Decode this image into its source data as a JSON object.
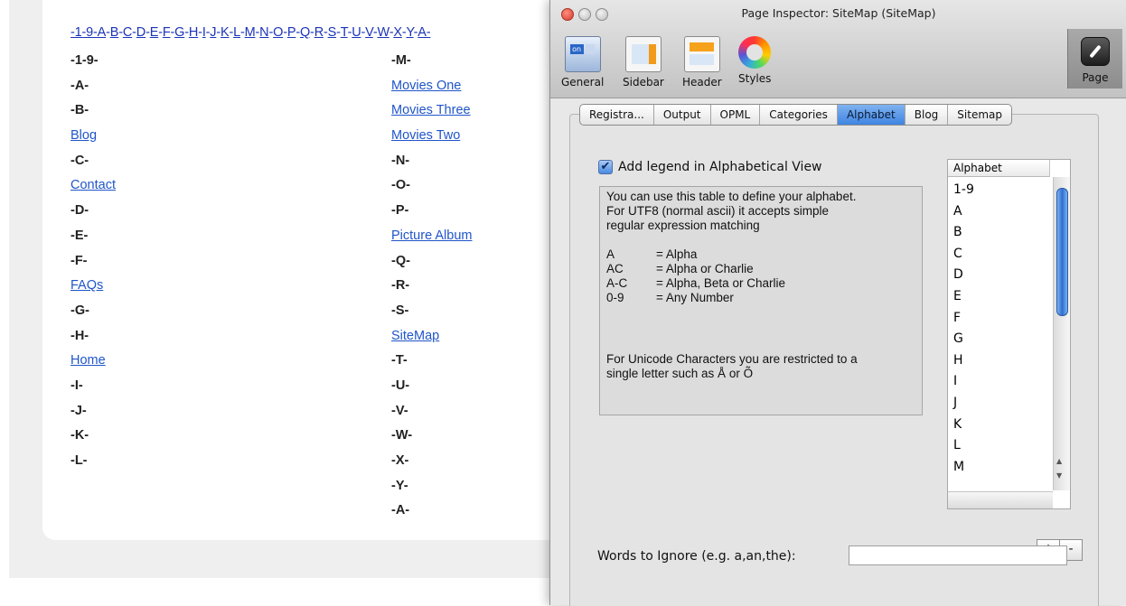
{
  "sitemap": {
    "alpha_nav": [
      "-1-9-",
      "A",
      "B",
      "C",
      "D",
      "E",
      "F",
      "G",
      "H",
      "I",
      "J",
      "K",
      "L",
      "M",
      "N",
      "O",
      "P",
      "Q",
      "R",
      "S",
      "T",
      "U",
      "V",
      "W",
      "X",
      "Y",
      "A-"
    ],
    "left_column": [
      {
        "text": "-1-9-",
        "type": "header"
      },
      {
        "text": "-A-",
        "type": "header"
      },
      {
        "text": "-B-",
        "type": "header"
      },
      {
        "text": "Blog",
        "type": "link"
      },
      {
        "text": "-C-",
        "type": "header"
      },
      {
        "text": "Contact",
        "type": "link"
      },
      {
        "text": "-D-",
        "type": "header"
      },
      {
        "text": "-E-",
        "type": "header"
      },
      {
        "text": "-F-",
        "type": "header"
      },
      {
        "text": "FAQs",
        "type": "link"
      },
      {
        "text": "-G-",
        "type": "header"
      },
      {
        "text": "-H-",
        "type": "header"
      },
      {
        "text": "Home",
        "type": "link"
      },
      {
        "text": "-I-",
        "type": "header"
      },
      {
        "text": "-J-",
        "type": "header"
      },
      {
        "text": "-K-",
        "type": "header"
      },
      {
        "text": "-L-",
        "type": "header"
      }
    ],
    "right_column": [
      {
        "text": "-M-",
        "type": "header"
      },
      {
        "text": "Movies One",
        "type": "link"
      },
      {
        "text": "Movies Three",
        "type": "link"
      },
      {
        "text": "Movies Two",
        "type": "link"
      },
      {
        "text": "-N-",
        "type": "header"
      },
      {
        "text": "-O-",
        "type": "header"
      },
      {
        "text": "-P-",
        "type": "header"
      },
      {
        "text": "Picture Album",
        "type": "link"
      },
      {
        "text": "-Q-",
        "type": "header"
      },
      {
        "text": "-R-",
        "type": "header"
      },
      {
        "text": "-S-",
        "type": "header"
      },
      {
        "text": "SiteMap",
        "type": "link"
      },
      {
        "text": "-T-",
        "type": "header"
      },
      {
        "text": "-U-",
        "type": "header"
      },
      {
        "text": "-V-",
        "type": "header"
      },
      {
        "text": "-W-",
        "type": "header"
      },
      {
        "text": "-X-",
        "type": "header"
      },
      {
        "text": "-Y-",
        "type": "header"
      },
      {
        "text": "-A-",
        "type": "header"
      }
    ]
  },
  "inspector": {
    "title": "Page Inspector: SiteMap (SiteMap)",
    "toolbar": {
      "general": {
        "label": "General",
        "icon": "general-icon"
      },
      "sidebar": {
        "label": "Sidebar",
        "icon": "sidebar-icon"
      },
      "header": {
        "label": "Header",
        "icon": "header-icon"
      },
      "styles": {
        "label": "Styles",
        "icon": "styles-icon"
      },
      "page": {
        "label": "Page",
        "icon": "page-icon"
      }
    },
    "tabs": [
      "Registra...",
      "Output",
      "OPML",
      "Categories",
      "Alphabet",
      "Blog",
      "Sitemap"
    ],
    "active_tab": "Alphabet",
    "legend_checkbox": {
      "label": "Add legend in Alphabetical View",
      "checked": true
    },
    "info": {
      "line1": "You can use this table to define your alphabet.",
      "line2": "For UTF8 (normal ascii) it accepts simple",
      "line3": "regular expression matching",
      "rules": [
        {
          "key": "A",
          "desc": "= Alpha"
        },
        {
          "key": "AC",
          "desc": "= Alpha or Charlie"
        },
        {
          "key": "A-C",
          "desc": "= Alpha, Beta or Charlie"
        },
        {
          "key": "0-9",
          "desc": "= Any Number"
        }
      ],
      "unicode1": "For Unicode Characters you are restricted to a",
      "unicode2": "single letter such as Å or Õ"
    },
    "alphabet_table": {
      "header": "Alphabet",
      "rows": [
        "1-9",
        "A",
        "B",
        "C",
        "D",
        "E",
        "F",
        "G",
        "H",
        "I",
        "J",
        "K",
        "L",
        "M"
      ]
    },
    "add_label": "+",
    "remove_label": "-",
    "ignore_label": "Words to Ignore (e.g. a,an,the):",
    "ignore_value": "",
    "colors": {
      "active_tab": "#3f85e2",
      "link": "#1f55c9"
    }
  }
}
